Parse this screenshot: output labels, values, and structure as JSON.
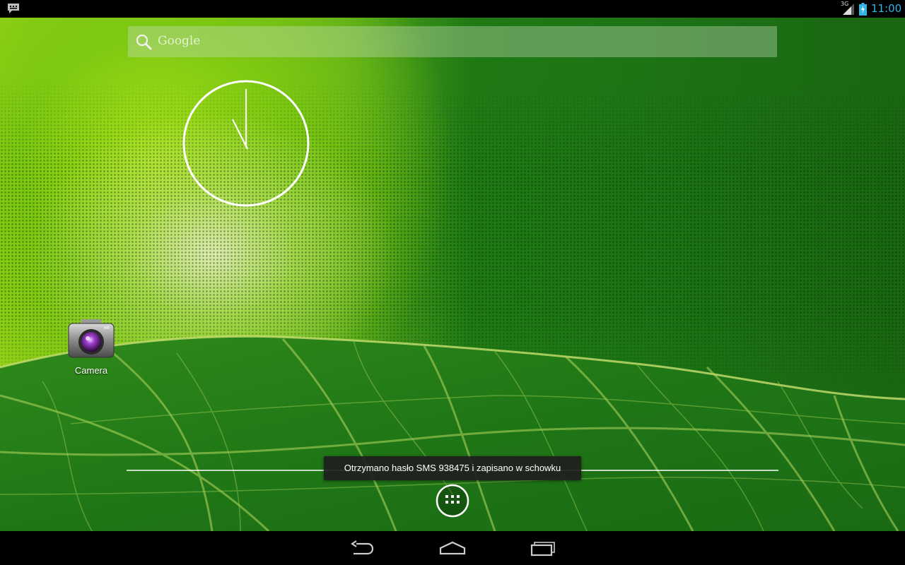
{
  "status_bar": {
    "notification_icon": "sms-notification-icon",
    "network_type": "3G",
    "battery_state": "charging",
    "time": "11:00",
    "time_color": "#33b5e5"
  },
  "search": {
    "label": "Google",
    "icon": "search-icon"
  },
  "widgets": {
    "analog_clock": {
      "hour": 11,
      "minute": 0
    }
  },
  "desktop": {
    "apps": [
      {
        "label": "Camera",
        "icon": "camera-icon"
      }
    ]
  },
  "hotseat": {
    "all_apps_icon": "all-apps-icon"
  },
  "toast": {
    "text": "Otrzymano hasło SMS 938475 i zapisano w schowku"
  },
  "nav_bar": {
    "buttons": [
      "back-icon",
      "home-icon",
      "recents-icon"
    ]
  }
}
